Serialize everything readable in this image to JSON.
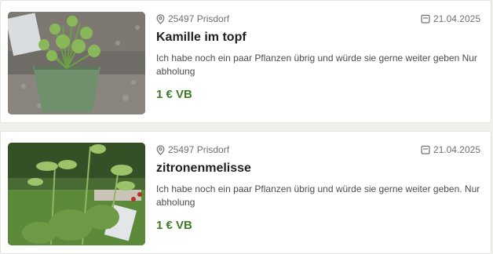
{
  "listings": [
    {
      "location": "25497 Prisdorf",
      "date": "21.04.2025",
      "title": "Kamille im topf",
      "description": "Ich habe noch ein paar Pflanzen übrig und würde sie gerne weiter geben Nur abholung",
      "price": "1 € VB",
      "image_icon": "chamomile-plant-photo"
    },
    {
      "location": "25497 Prisdorf",
      "date": "21.04.2025",
      "title": "zitronenmelisse",
      "description": "Ich habe noch ein paar Pflanzen übrig und würde sie gerne weiter geben. Nur abholung",
      "price": "1 € VB",
      "image_icon": "lemon-balm-plant-photo"
    }
  ],
  "icons": {
    "location": "map-pin-icon",
    "date": "calendar-icon"
  },
  "colors": {
    "price": "#3f7a28",
    "meta": "#6f6f6f"
  }
}
